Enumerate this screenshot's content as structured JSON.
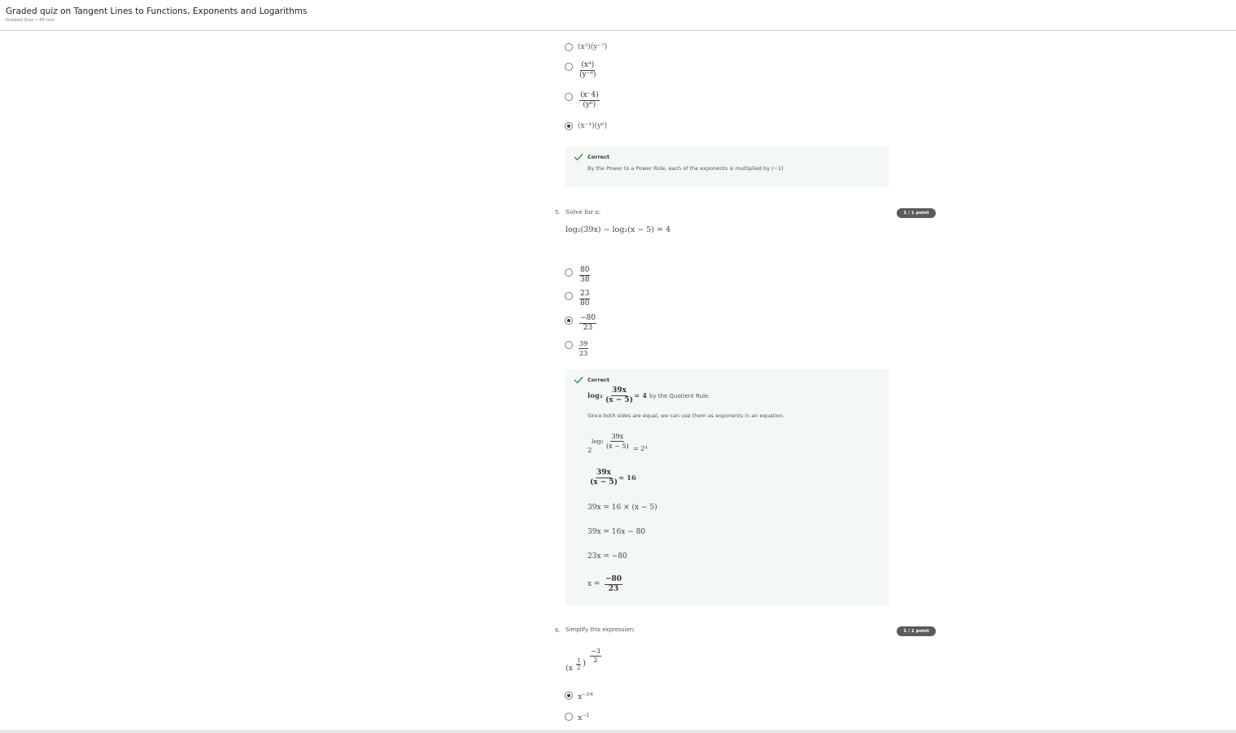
{
  "header": {
    "title": "Graded quiz on Tangent Lines to Functions, Exponents and Logarithms",
    "subtitle": "Graded Quiz • 45 min"
  },
  "q4": {
    "options": [
      {
        "id": "a",
        "text": "(x³)(y⁻⁷)",
        "checked": false
      },
      {
        "id": "b",
        "num": "(x⁴)",
        "den": "(y⁻⁶)",
        "checked": false
      },
      {
        "id": "c",
        "num": "(x⁻4)",
        "den": "(y⁶)",
        "checked": false
      },
      {
        "id": "d",
        "text": "(x⁻⁴)(y⁶)",
        "checked": true
      }
    ],
    "feedback": {
      "status": "Correct",
      "text": "By the Power to a Power Rule, each of the exponents is multiplied by (−1)"
    }
  },
  "q5": {
    "number": "5.",
    "prompt": "Solve for x:",
    "badge": "1 / 1 point",
    "equation": "log₂(39x) − log₂(x − 5) = 4",
    "options": [
      {
        "num": "80",
        "den": "38",
        "checked": false
      },
      {
        "num": "23",
        "den": "80",
        "checked": false
      },
      {
        "num": "−80",
        "den": "23",
        "checked": true
      },
      {
        "num": "39",
        "den": "23",
        "checked": false
      }
    ],
    "feedback": {
      "status": "Correct",
      "line1_prefix": "log₂",
      "line1_num": "39x",
      "line1_den": "(x − 5)",
      "line1_suffix": "= 4",
      "line1_text": "by the Quotient Rule.",
      "line2": "Since both sides are equal, we can use them as exponents in an equation.",
      "step1_base": "2",
      "step1_log": "log₂",
      "step1_num": "39x",
      "step1_den": "(x − 5)",
      "step1_rhs": "= 2⁴",
      "step2_num": "39x",
      "step2_den": "(x − 5)",
      "step2_rhs": "= 16",
      "step3": "39x = 16 × (x − 5)",
      "step4": "39x = 16x − 80",
      "step5": "23x = −80",
      "step6_lhs": "x =",
      "step6_num": "−80",
      "step6_den": "23"
    }
  },
  "q6": {
    "number": "6.",
    "prompt": "Simplify this expression:",
    "badge": "1 / 1 point",
    "expr_base": "(x",
    "expr_inner_num": "1",
    "expr_inner_den": "2",
    "expr_close": ")",
    "expr_outer_num": "−3",
    "expr_outer_den": "2",
    "options": [
      {
        "base": "x",
        "exp": "−3/4",
        "checked": true
      },
      {
        "base": "x",
        "exp": "−1",
        "checked": false
      }
    ]
  }
}
